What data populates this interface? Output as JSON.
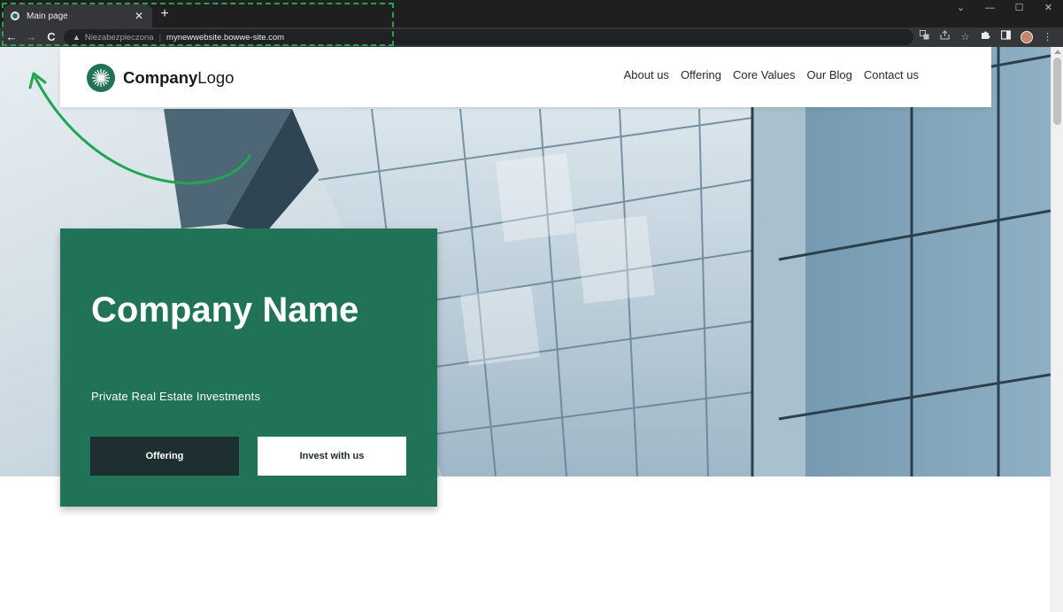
{
  "browser": {
    "tab_title": "Main page",
    "tab_close": "✕",
    "new_tab": "+",
    "back": "←",
    "forward": "→",
    "reload": "C",
    "security_icon": "▲",
    "security_label": "Niezabezpieczona",
    "url": "mynewwebsite.bowwe-site.com",
    "window_controls": [
      "⌄",
      "—",
      "☐",
      "✕"
    ],
    "toolbar_icons": [
      "translate-icon",
      "share-icon",
      "star-icon",
      "puzzle-icon",
      "sidepanel-icon",
      "profile-avatar",
      "menu-dots-icon"
    ]
  },
  "site": {
    "logo_bold": "Company",
    "logo_light": "Logo",
    "nav": [
      "About us",
      "Offering",
      "Core Values",
      "Our Blog",
      "Contact us"
    ],
    "hero_title": "Company Name",
    "hero_subtitle": "Private Real Estate Investments",
    "btn_primary": "Offering",
    "btn_secondary": "Invest with us"
  },
  "colors": {
    "brand_green": "#217357",
    "dark_button": "#1e2f31",
    "annotation_green": "#1fa64e"
  }
}
